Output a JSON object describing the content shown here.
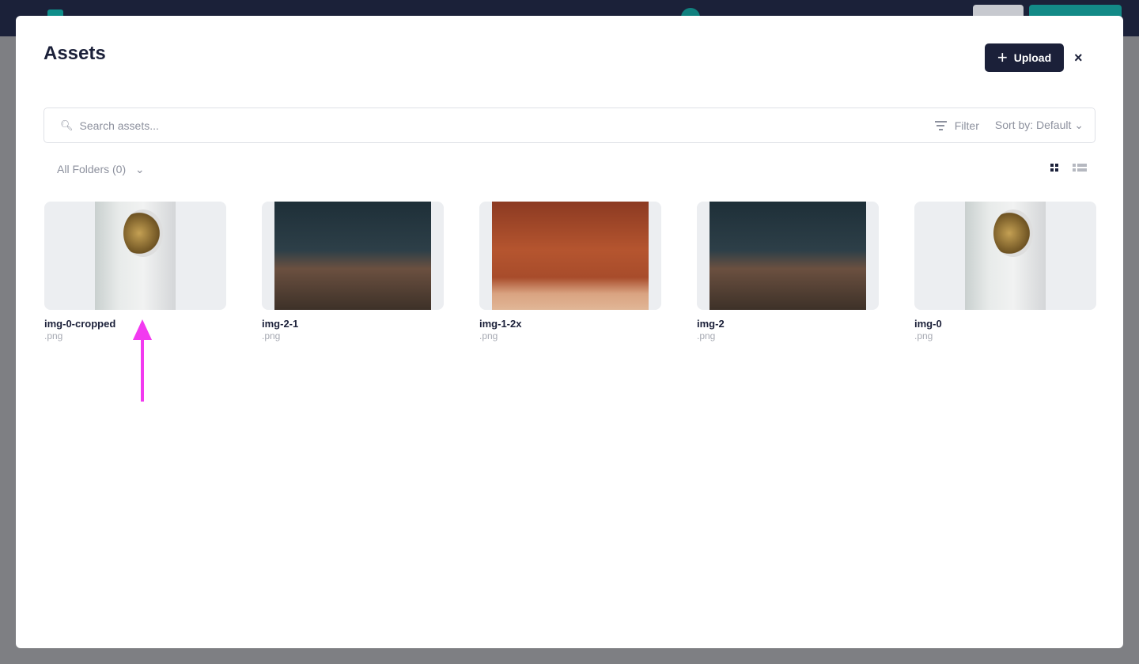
{
  "modal": {
    "title": "Assets",
    "upload_label": "Upload",
    "close_label": "×",
    "search": {
      "placeholder": "Search assets...",
      "value": ""
    },
    "filter_label": "Filter",
    "sort_label": "Sort by: Default",
    "folders_label": "All Folders (0)",
    "assets": [
      {
        "name": "img-0-cropped",
        "ext": ".png",
        "type": "astronaut"
      },
      {
        "name": "img-2-1",
        "ext": ".png",
        "type": "night"
      },
      {
        "name": "img-1-2x",
        "ext": ".png",
        "type": "mars"
      },
      {
        "name": "img-2",
        "ext": ".png",
        "type": "night"
      },
      {
        "name": "img-0",
        "ext": ".png",
        "type": "astronaut"
      }
    ]
  },
  "colors": {
    "primary": "#1b2039",
    "accent": "#138a87",
    "annotation": "#f23af0"
  }
}
